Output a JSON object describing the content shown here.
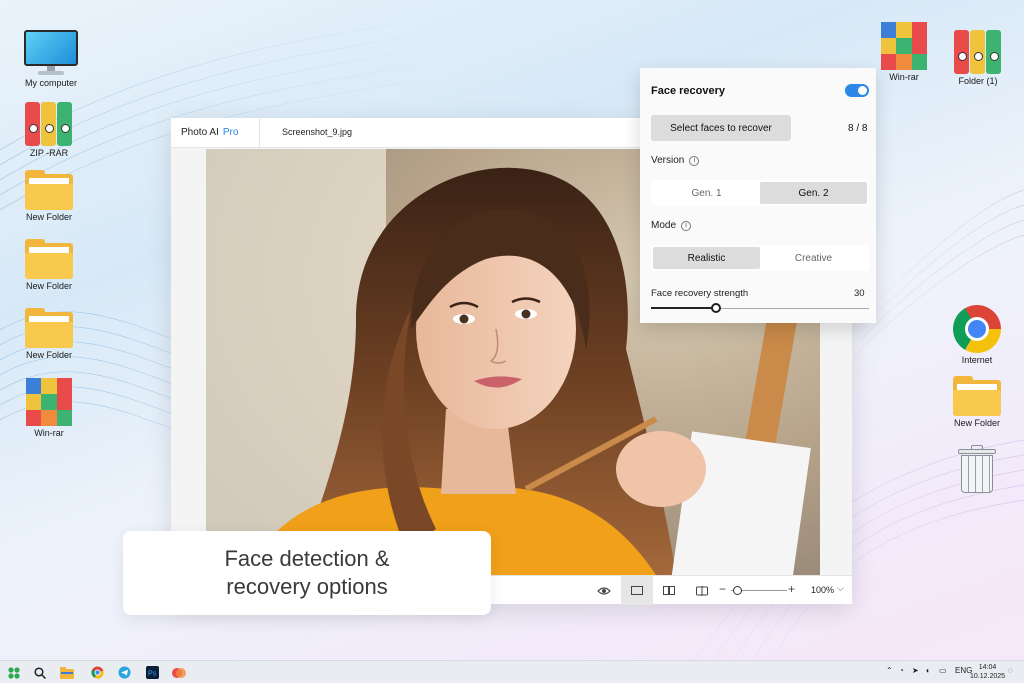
{
  "desktop": {
    "icons_left": [
      {
        "label": "My computer"
      },
      {
        "label": "ZIP -RAR"
      },
      {
        "label": "New Folder"
      },
      {
        "label": "New Folder"
      },
      {
        "label": "New Folder"
      },
      {
        "label": "Win-rar"
      }
    ],
    "icons_right": [
      {
        "label": "Win-rar"
      },
      {
        "label": "Folder (1)"
      },
      {
        "label": "Internet"
      },
      {
        "label": "New Folder"
      },
      {
        "label": "Recycle Bin"
      }
    ]
  },
  "app": {
    "name": "Photo AI",
    "badge": "Pro",
    "filename": "Screenshot_9.jpg",
    "zoom": "100%",
    "zoom_level": 0.1
  },
  "panel": {
    "title": "Face recovery",
    "enabled": true,
    "select_button": "Select faces to recover",
    "count": "8 / 8",
    "version_label": "Version",
    "version_options": [
      "Gen. 1",
      "Gen. 2"
    ],
    "version_selected": "Gen. 2",
    "mode_label": "Mode",
    "mode_options": [
      "Realistic",
      "Creative"
    ],
    "mode_selected": "Realistic",
    "strength_label": "Face recovery strength",
    "strength_value": "30",
    "strength_fraction": 0.3
  },
  "caption": {
    "text": "Face detection & recovery options"
  },
  "taskbar": {
    "language": "ENG",
    "time": "14:04",
    "date": "10.12.2025"
  },
  "colors": {
    "accent": "#2b88e6",
    "toggle_on": "#2b88e6"
  }
}
